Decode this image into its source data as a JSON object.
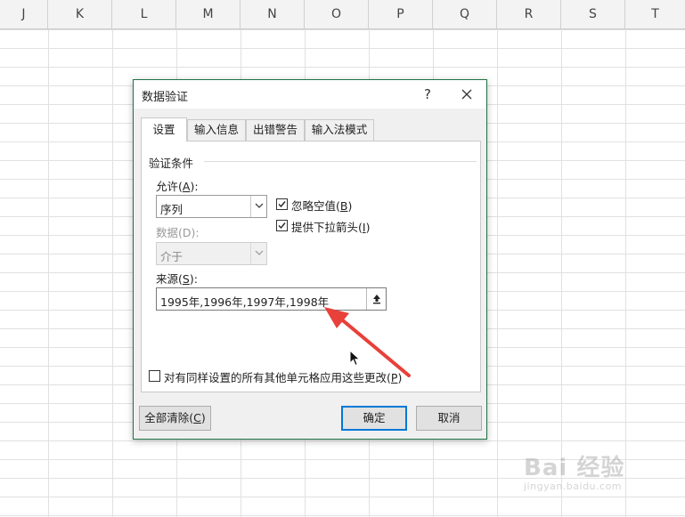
{
  "spreadsheet": {
    "columns": [
      "J",
      "K",
      "L",
      "M",
      "N",
      "O",
      "P",
      "Q",
      "R",
      "S",
      "T"
    ]
  },
  "dialog": {
    "title": "数据验证",
    "help_label": "?",
    "close_label": "✕",
    "tabs": [
      {
        "label": "设置",
        "active": true
      },
      {
        "label": "输入信息",
        "active": false
      },
      {
        "label": "出错警告",
        "active": false
      },
      {
        "label": "输入法模式",
        "active": false
      }
    ],
    "settings": {
      "group_title": "验证条件",
      "allow_label_prefix": "允许(",
      "allow_label_key": "A",
      "allow_label_suffix": "):",
      "allow_value": "序列",
      "data_label": "数据(D):",
      "data_value": "介于",
      "ignore_blank": {
        "prefix": "忽略空值(",
        "key": "B",
        "suffix": ")",
        "checked": true
      },
      "dropdown": {
        "prefix": "提供下拉箭头(",
        "key": "I",
        "suffix": ")",
        "checked": true
      },
      "source_label_prefix": "来源(",
      "source_label_key": "S",
      "source_label_suffix": "):",
      "source_value": "1995年,1996年,1997年,1998年",
      "apply_all": {
        "prefix": "对有同样设置的所有其他单元格应用这些更改(",
        "key": "P",
        "suffix": ")",
        "checked": false
      }
    },
    "buttons": {
      "clear_prefix": "全部清除(",
      "clear_key": "C",
      "clear_suffix": ")",
      "ok": "确定",
      "cancel": "取消"
    }
  },
  "icons": {
    "collapse": "range-select-icon",
    "dropdown": "chevron-down-icon",
    "check": "checkmark-icon",
    "cursor": "mouse-pointer-icon",
    "annotation": "red-arrow-annotation"
  },
  "colors": {
    "dialog_border": "#1e7145",
    "default_button": "#0078d7",
    "arrow": "#e8403a"
  },
  "watermark": {
    "main": "Bai 经验",
    "sub": "jingyan.baidu.com"
  }
}
